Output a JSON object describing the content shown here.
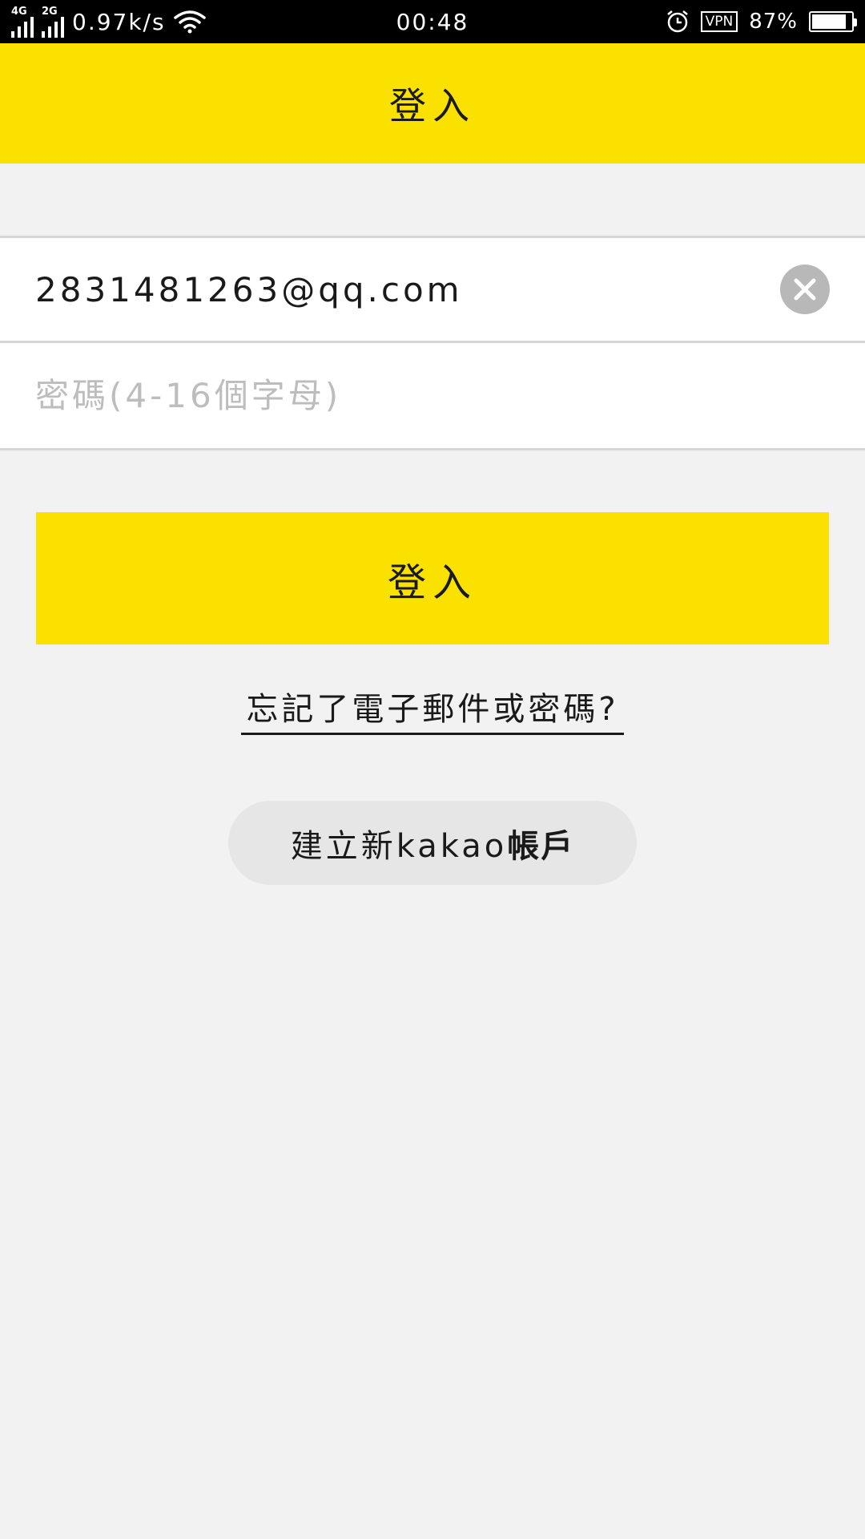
{
  "status_bar": {
    "net1": "4G",
    "net2": "2G",
    "speed": "0.97k/s",
    "time": "00:48",
    "vpn": "VPN",
    "battery": "87%",
    "battery_level": 0.87
  },
  "header": {
    "title": "登入"
  },
  "form": {
    "email_value": "2831481263@qq.com",
    "password_placeholder": "密碼(4-16個字母)"
  },
  "actions": {
    "login_label": "登入",
    "forgot_label": "忘記了電子郵件或密碼?",
    "create_prefix": "建立新kakao",
    "create_bold": "帳戶"
  },
  "colors": {
    "brand_yellow": "#fae100",
    "background": "#f2f2f2",
    "clear_icon_bg": "#b8b8b8"
  }
}
